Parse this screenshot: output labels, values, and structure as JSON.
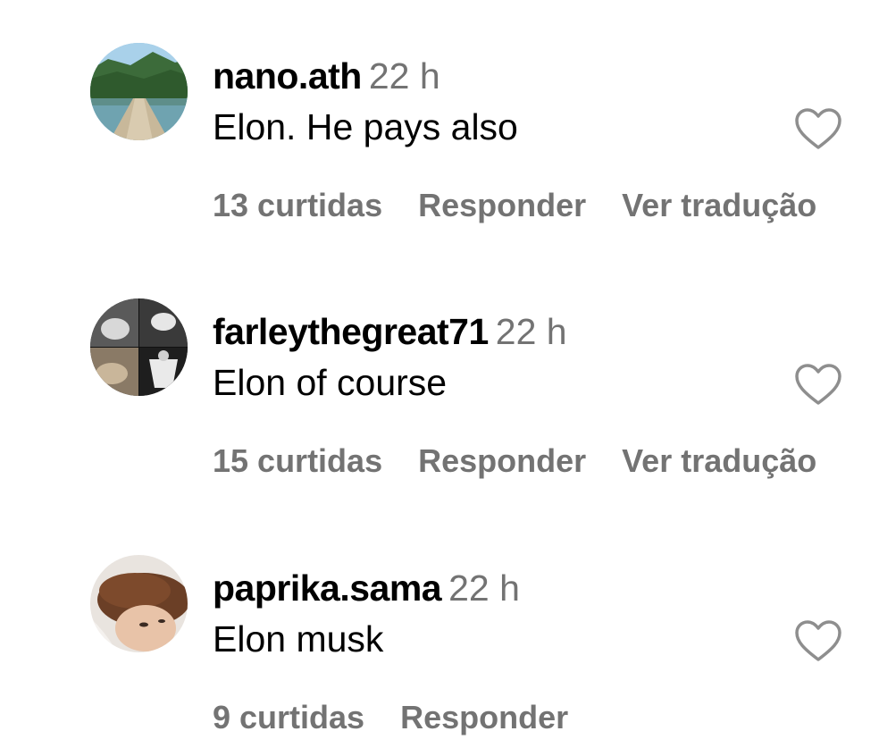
{
  "comments": [
    {
      "username": "nano.ath",
      "time": "22 h",
      "text": "Elon. He pays also",
      "likes": "13 curtidas",
      "reply": "Responder",
      "translate": "Ver tradução",
      "avatar": "lake-dock-photo"
    },
    {
      "username": "farleythegreat71",
      "time": "22 h",
      "text": "Elon of course",
      "likes": "15 curtidas",
      "reply": "Responder",
      "translate": "Ver tradução",
      "avatar": "collage-photo"
    },
    {
      "username": "paprika.sama",
      "time": "22 h",
      "text": "Elon musk",
      "likes": "9 curtidas",
      "reply": "Responder",
      "avatar": "face-photo"
    }
  ],
  "icons": {
    "like": "heart-outline-icon"
  },
  "colors": {
    "text": "#000000",
    "muted": "#737373",
    "heart_stroke": "#8e8e8e"
  }
}
